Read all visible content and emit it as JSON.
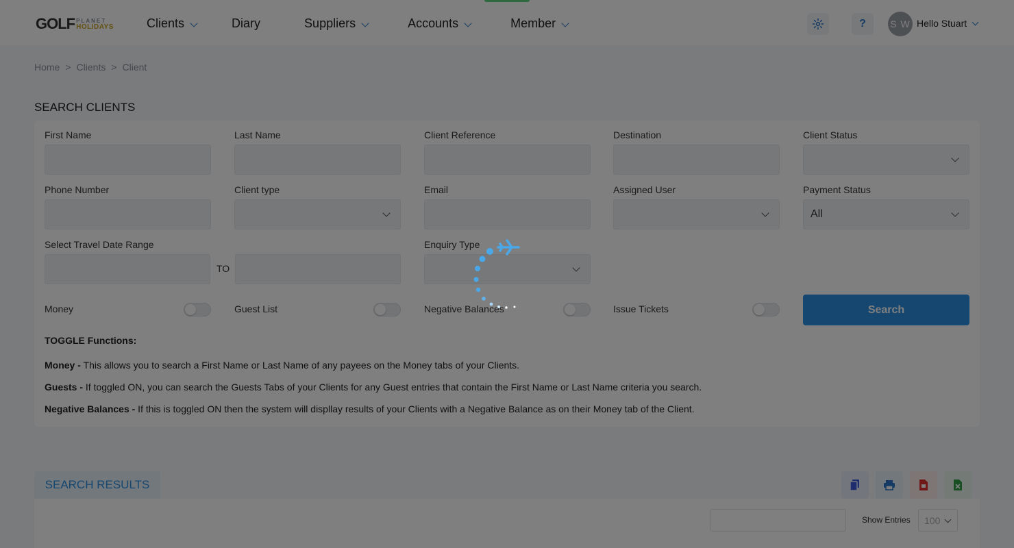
{
  "brand": {
    "logo_main": "GOLF",
    "logo_sub1": "PLANET",
    "logo_sub2": "HOLIDAYS"
  },
  "nav": {
    "items": [
      {
        "label": "Clients",
        "has_dropdown": true
      },
      {
        "label": "Diary",
        "has_dropdown": false
      },
      {
        "label": "Suppliers",
        "has_dropdown": true
      },
      {
        "label": "Accounts",
        "has_dropdown": true
      },
      {
        "label": "Member",
        "has_dropdown": true
      }
    ],
    "settings_icon": "gear-icon",
    "help_icon": "question-icon",
    "help_glyph": "?",
    "user_initials": "S W",
    "user_greeting": "Hello Stuart"
  },
  "breadcrumb": {
    "items": [
      "Home",
      ">",
      "Clients",
      ">",
      "Client"
    ]
  },
  "page": {
    "title": "SEARCH CLIENTS"
  },
  "form": {
    "first_name": {
      "label": "First Name",
      "value": ""
    },
    "last_name": {
      "label": "Last Name",
      "value": ""
    },
    "client_reference": {
      "label": "Client Reference",
      "value": ""
    },
    "destination": {
      "label": "Destination",
      "value": ""
    },
    "client_status": {
      "label": "Client Status",
      "value": ""
    },
    "phone_number": {
      "label": "Phone Number",
      "value": ""
    },
    "client_type": {
      "label": "Client type",
      "value": ""
    },
    "email": {
      "label": "Email",
      "value": ""
    },
    "assigned_user": {
      "label": "Assigned User",
      "value": ""
    },
    "payment_status": {
      "label": "Payment Status",
      "value": "All"
    },
    "travel_date_range": {
      "label": "Select Travel Date Range",
      "to_label": "TO",
      "from": "",
      "to": ""
    },
    "enquiry_type": {
      "label": "Enquiry Type",
      "value": ""
    },
    "toggles": {
      "money": {
        "label": "Money",
        "on": false
      },
      "guest_list": {
        "label": "Guest List",
        "on": false
      },
      "negative_balances": {
        "label": "Negative Balances",
        "on": false
      },
      "issue_tickets": {
        "label": "Issue Tickets",
        "on": false
      }
    },
    "search_button": "Search"
  },
  "help": {
    "heading": "TOGGLE Functions:",
    "money_term": "Money -",
    "money_text": " This allows you to search a First Name or Last Name of any payees on the Money tabs of your Clients.",
    "guests_term": "Guests -",
    "guests_text": " If toggled ON, you can search the Guests Tabs of your Clients for any Guest entries that contain the First Name or Last Name criteria you search.",
    "negative_term": "Negative Balances -",
    "negative_text": " If this is toggled ON then the system will displlay results of your Clients with a Negative Balance as on their Money tab of the Client."
  },
  "results": {
    "tab_label": "SEARCH RESULTS",
    "export_icons": [
      "copy-icon",
      "print-icon",
      "pdf-icon",
      "excel-icon"
    ],
    "show_entries_label": "Show Entries",
    "entries_value": "100",
    "search_value": ""
  },
  "colors": {
    "accent": "#2a8fe0",
    "nav_chevron": "#2a76c9",
    "overlay": "rgba(0,0,0,0.5)",
    "loader": "#4aa8e8",
    "copy": "#3b5bdb",
    "print": "#2a76c9",
    "pdf": "#e03131",
    "excel": "#2f9e44"
  },
  "loading": {
    "visible": true,
    "icon": "airplane-loader-icon"
  }
}
